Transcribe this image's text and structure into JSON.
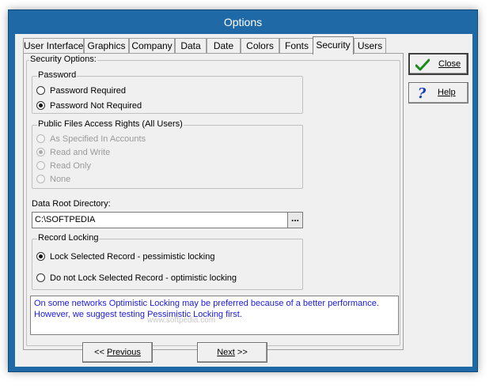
{
  "window": {
    "title": "Options"
  },
  "tabs": [
    {
      "label": "User Interface",
      "active": false
    },
    {
      "label": "Graphics",
      "active": false
    },
    {
      "label": "Company",
      "active": false
    },
    {
      "label": "Data",
      "active": false
    },
    {
      "label": "Date",
      "active": false
    },
    {
      "label": "Colors",
      "active": false
    },
    {
      "label": "Fonts",
      "active": false
    },
    {
      "label": "Security",
      "active": true
    },
    {
      "label": "Users",
      "active": false
    }
  ],
  "security_options": {
    "legend": "Security Options:",
    "password": {
      "legend": "Password",
      "options": [
        {
          "label": "Password Required",
          "checked": false,
          "enabled": true
        },
        {
          "label": "Password Not Required",
          "checked": true,
          "enabled": true
        }
      ]
    },
    "public_files": {
      "legend": "Public Files Access Rights (All Users)",
      "options": [
        {
          "label": "As Specified In Accounts",
          "checked": false,
          "enabled": false
        },
        {
          "label": "Read and Write",
          "checked": true,
          "enabled": false
        },
        {
          "label": "Read Only",
          "checked": false,
          "enabled": false
        },
        {
          "label": "None",
          "checked": false,
          "enabled": false
        }
      ]
    },
    "data_root": {
      "label": "Data Root Directory:",
      "value": "C:\\SOFTPEDIA",
      "browse_label": "..."
    },
    "record_locking": {
      "legend": "Record Locking",
      "options": [
        {
          "label": "Lock Selected Record - pessimistic locking",
          "checked": true,
          "enabled": true
        },
        {
          "label": "Do not Lock Selected Record - optimistic locking",
          "checked": false,
          "enabled": true
        }
      ]
    },
    "info": {
      "line1": "On some networks Optimistic Locking may be preferred because of a better performance.",
      "line2": "However, we suggest testing Pessimistic Locking first.",
      "watermark": "www.softpedia.com"
    }
  },
  "side_buttons": {
    "close_label": "Close",
    "help_label": "Help",
    "help_icon_glyph": "?"
  },
  "bottom_buttons": {
    "previous_prefix": "<< ",
    "previous_label": "Previous",
    "next_label": "Next",
    "next_suffix": " >>"
  },
  "colors": {
    "title_bar": "#1f6aa6",
    "info_text": "#1a1ae0",
    "check_icon": "#1a8a1a",
    "help_icon": "#1b3fb0"
  }
}
